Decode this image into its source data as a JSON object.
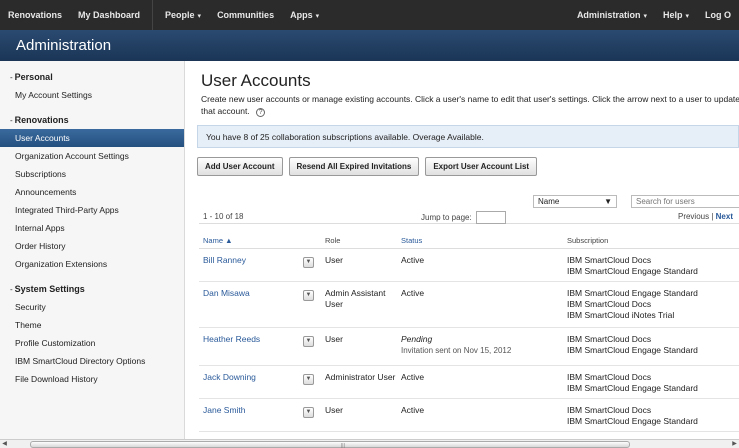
{
  "topnav": {
    "left": [
      {
        "label": "Renovations"
      },
      {
        "label": "My Dashboard"
      },
      {
        "label": "People",
        "caret": "▾"
      },
      {
        "label": "Communities"
      },
      {
        "label": "Apps",
        "caret": "▾"
      }
    ],
    "right": [
      {
        "label": "Administration",
        "caret": "▾"
      },
      {
        "label": "Help",
        "caret": "▾"
      },
      {
        "label": "Log O"
      }
    ]
  },
  "header": {
    "title": "Administration"
  },
  "sidebar": {
    "sections": [
      {
        "title": "Personal",
        "toggle": "-",
        "items": [
          "My Account Settings"
        ]
      },
      {
        "title": "Renovations",
        "toggle": "-",
        "items": [
          "User Accounts",
          "Organization Account Settings",
          "Subscriptions",
          "Announcements",
          "Integrated Third-Party Apps",
          "Internal Apps",
          "Order History",
          "Organization Extensions"
        ],
        "active": "User Accounts"
      },
      {
        "title": "System Settings",
        "toggle": "-",
        "items": [
          "Security",
          "Theme",
          "Profile Customization",
          "IBM SmartCloud Directory Options",
          "File Download History"
        ]
      }
    ]
  },
  "main": {
    "title": "User Accounts",
    "description": "Create new user accounts or manage existing accounts. Click a user's name to edit that user's settings. Click the arrow next to a user to update that account.",
    "help_glyph": "?",
    "notice": "You have 8 of 25 collaboration subscriptions available. Overage Available.",
    "buttons": [
      "Add User Account",
      "Resend All Expired Invitations",
      "Export User Account List"
    ],
    "filter": {
      "select_value": "Name",
      "search_placeholder": "Search for users"
    },
    "pager": {
      "range": "1 - 10 of 18",
      "jump_label": "Jump to page:",
      "previous": "Previous",
      "separator": "|",
      "next": "Next"
    },
    "table": {
      "headers": {
        "name": "Name",
        "sort_glyph": "▲",
        "role": "Role",
        "status": "Status",
        "subscription": "Subscription"
      },
      "rows": [
        {
          "name": "Bill Ranney",
          "role": "User",
          "status": "Active",
          "status_note": "",
          "subs": [
            "IBM SmartCloud Docs",
            "IBM SmartCloud Engage Standard"
          ]
        },
        {
          "name": "Dan Misawa",
          "role": "Admin Assistant User",
          "status": "Active",
          "status_note": "",
          "subs": [
            "IBM SmartCloud Engage Standard",
            "IBM SmartCloud Docs",
            "IBM SmartCloud iNotes Trial"
          ]
        },
        {
          "name": "Heather Reeds",
          "role": "User",
          "status": "Pending",
          "status_note": "Invitation sent on Nov 15, 2012",
          "subs": [
            "IBM SmartCloud Docs",
            "IBM SmartCloud Engage Standard"
          ]
        },
        {
          "name": "Jack Downing",
          "role": "Administrator User",
          "status": "Active",
          "status_note": "",
          "subs": [
            "IBM SmartCloud Docs",
            "IBM SmartCloud Engage Standard"
          ]
        },
        {
          "name": "Jane Smith",
          "role": "User",
          "status": "Active",
          "status_note": "",
          "subs": [
            "IBM SmartCloud Docs",
            "IBM SmartCloud Engage Standard"
          ]
        }
      ]
    }
  },
  "icons": {
    "row_action": "chevron-down-icon",
    "help": "help-icon"
  },
  "colors": {
    "topnav": "#2b2b2b",
    "header": "#1f3a5c",
    "active_item": "#2d5a8c",
    "link": "#2a5a9a",
    "notice_bg": "#e6eef7"
  }
}
